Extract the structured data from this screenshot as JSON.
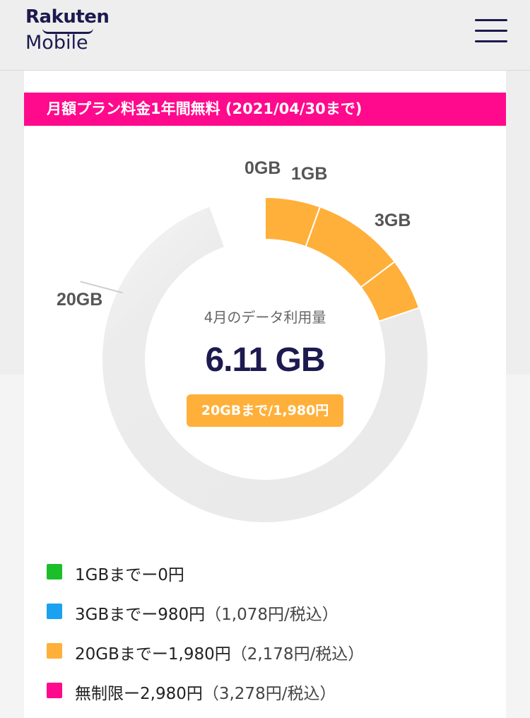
{
  "header": {
    "logo_top": "Rakuten",
    "logo_bottom": "Mobile",
    "menu_icon": "hamburger-menu-icon"
  },
  "promo": {
    "text": "月額プラン料金1年間無料 (2021/04/30まで)"
  },
  "usage": {
    "caption": "4月のデータ利用量",
    "value": "6.11 GB",
    "badge": "20GBまで/1,980円"
  },
  "chart_data": {
    "type": "donut",
    "ticks": [
      "0GB",
      "1GB",
      "3GB",
      "20GB"
    ],
    "used_gb": 6.11,
    "segments": [
      {
        "label": "0GB–1GB",
        "from": 0,
        "to": 1,
        "color": "#ffb03a"
      },
      {
        "label": "1GB–3GB",
        "from": 1,
        "to": 3,
        "color": "#ffb03a"
      },
      {
        "label": "3GB–6.11GB",
        "from": 3,
        "to": 6.11,
        "color": "#ffb03a"
      }
    ],
    "track_color": "#ececec"
  },
  "legend": [
    {
      "label": "1GBまでー0円",
      "note": "",
      "color": "#1bbf2a"
    },
    {
      "label": "3GBまでー980円",
      "note": "（1,078円/税込）",
      "color": "#1aa2f0"
    },
    {
      "label": "20GBまでー1,980円",
      "note": "（2,178円/税込）",
      "color": "#ffb03a"
    },
    {
      "label": "無制限ー2,980円",
      "note": "（3,278円/税込）",
      "color": "#ff0a8c"
    }
  ]
}
